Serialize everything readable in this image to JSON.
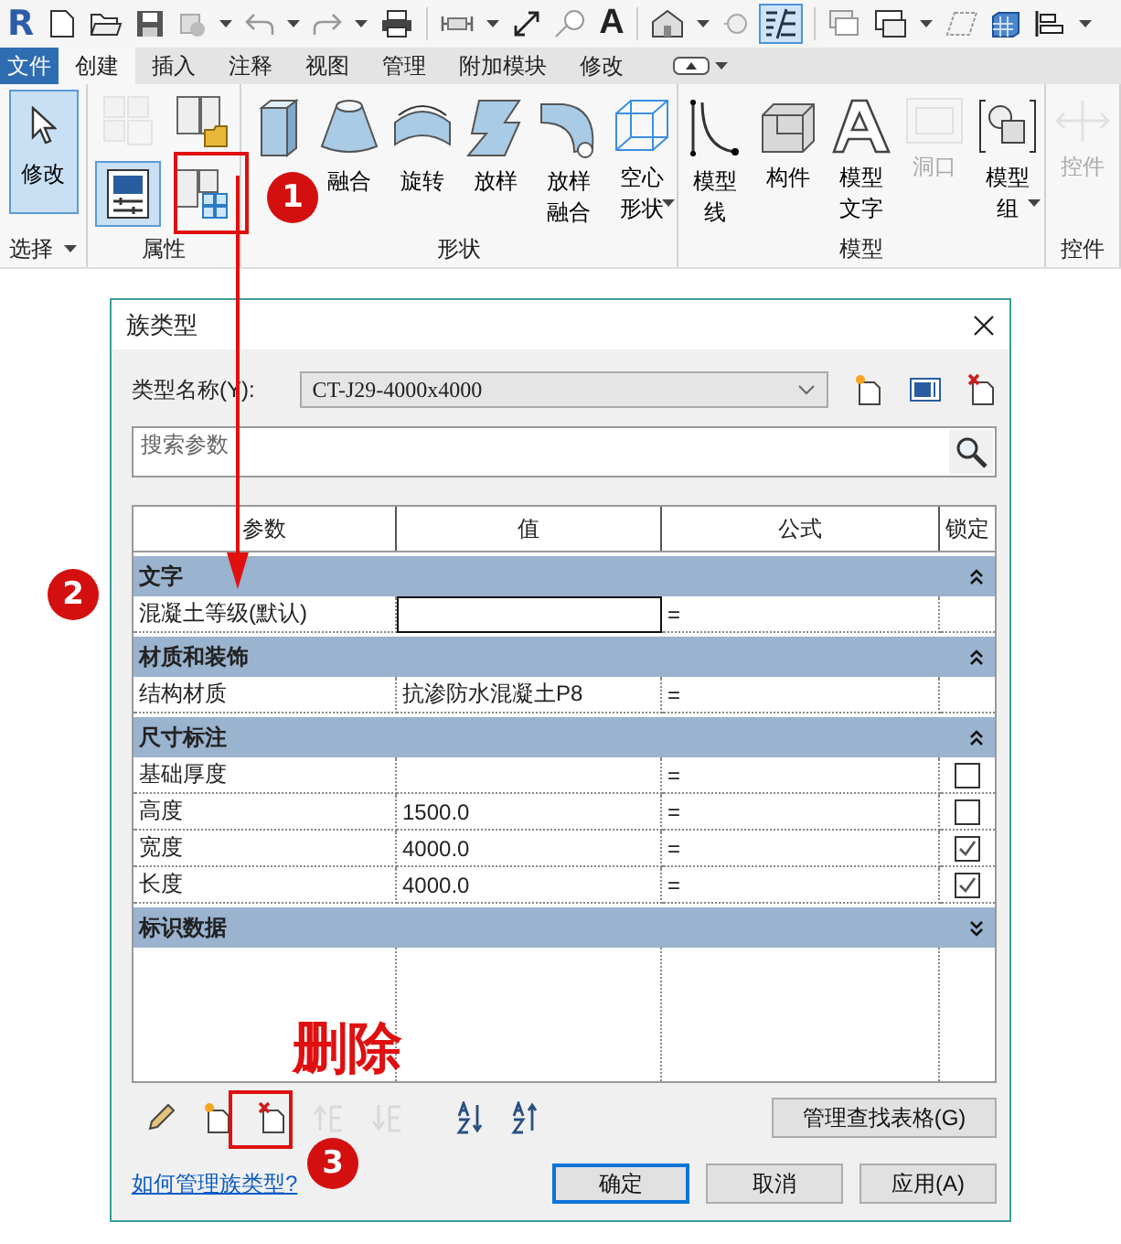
{
  "quick_access": {
    "logo": "R",
    "text_tool": "A"
  },
  "ribbon_tabs": [
    {
      "label": "文件",
      "kind": "file",
      "selected": false
    },
    {
      "label": "创建",
      "kind": "tab",
      "selected": true
    },
    {
      "label": "插入",
      "kind": "tab",
      "selected": false
    },
    {
      "label": "注释",
      "kind": "tab",
      "selected": false
    },
    {
      "label": "视图",
      "kind": "tab",
      "selected": false
    },
    {
      "label": "管理",
      "kind": "tab",
      "selected": false
    },
    {
      "label": "附加模块",
      "kind": "tab",
      "selected": false
    },
    {
      "label": "修改",
      "kind": "tab",
      "selected": false
    }
  ],
  "ribbon": {
    "panels": [
      {
        "title": "选择",
        "has_menu": true,
        "items": [
          {
            "kind": "tall",
            "label": "修改",
            "selected": true,
            "disabled": false
          }
        ]
      },
      {
        "title": "属性",
        "items": [
          {
            "kind": "small",
            "selected": false,
            "disabled": true
          },
          {
            "kind": "small",
            "selected": false,
            "disabled": false
          },
          {
            "kind": "small",
            "selected": true,
            "disabled": false
          },
          {
            "kind": "small",
            "selected": false,
            "disabled": false
          }
        ]
      },
      {
        "title": "形状",
        "items": [
          {
            "kind": "large",
            "selected": false,
            "disabled": false
          },
          {
            "kind": "large",
            "label": "融合",
            "selected": false,
            "disabled": false
          },
          {
            "kind": "large",
            "label": "旋转",
            "selected": false,
            "disabled": false
          },
          {
            "kind": "large",
            "label": "放样",
            "selected": false,
            "disabled": false
          },
          {
            "kind": "large",
            "label": "放样融合",
            "selected": false,
            "disabled": false
          },
          {
            "kind": "large",
            "label": "空心形状",
            "has_menu": true,
            "selected": false,
            "disabled": false
          }
        ]
      },
      {
        "title": "模型",
        "items": [
          {
            "kind": "large",
            "label": "模型线",
            "selected": false,
            "disabled": false
          },
          {
            "kind": "large",
            "label": "构件",
            "selected": false,
            "disabled": false
          },
          {
            "kind": "large",
            "label": "模型文字",
            "selected": false,
            "disabled": false
          },
          {
            "kind": "large",
            "label": "洞口",
            "selected": false,
            "disabled": true
          },
          {
            "kind": "large",
            "label": "模型组",
            "has_menu": true,
            "selected": false,
            "disabled": false
          }
        ]
      },
      {
        "title": "控件",
        "items": [
          {
            "kind": "large",
            "label": "控件",
            "selected": false,
            "disabled": true
          }
        ]
      }
    ]
  },
  "dialog": {
    "title": "族类型",
    "type_name": {
      "label": "类型名称(Y):",
      "value": "CT-J29-4000x4000"
    },
    "search": {
      "placeholder": "搜索参数"
    },
    "table": {
      "columns": [
        "参数",
        "值",
        "公式",
        "锁定"
      ],
      "groups": [
        {
          "name": "文字",
          "expanded": true,
          "rows": [
            {
              "parameter": "混凝土等级(默认)",
              "formula": "=",
              "selected": true
            }
          ]
        },
        {
          "name": "材质和装饰",
          "expanded": true,
          "rows": [
            {
              "parameter": "结构材质",
              "value": "抗渗防水混凝土P8",
              "formula": "=",
              "selected": false
            }
          ]
        },
        {
          "name": "尺寸标注",
          "expanded": true,
          "rows": [
            {
              "parameter": "基础厚度",
              "formula": "=",
              "locked": false,
              "selected": false
            },
            {
              "parameter": "高度",
              "value": "1500.0",
              "formula": "=",
              "locked": false,
              "selected": false
            },
            {
              "parameter": "宽度",
              "value": "4000.0",
              "formula": "=",
              "locked": true,
              "selected": false
            },
            {
              "parameter": "长度",
              "value": "4000.0",
              "formula": "=",
              "locked": true,
              "selected": false
            }
          ]
        },
        {
          "name": "标识数据",
          "expanded": false
        }
      ]
    },
    "toolbar": [
      {
        "disabled": false
      },
      {
        "disabled": false
      },
      {
        "disabled": false
      },
      {
        "disabled": true
      },
      {
        "disabled": true
      },
      {
        "disabled": false
      },
      {
        "disabled": false
      }
    ],
    "lookup_button": "管理查找表格(G)",
    "help_link": "如何管理族类型?",
    "buttons": [
      {
        "label": "确定",
        "default": true
      },
      {
        "label": "取消",
        "default": false
      },
      {
        "label": "应用(A)",
        "default": false
      }
    ]
  },
  "annotations": {
    "badges": [
      "1",
      "2",
      "3"
    ],
    "note": "删除"
  }
}
